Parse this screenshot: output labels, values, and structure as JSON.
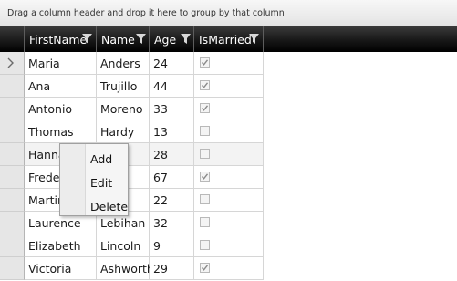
{
  "group_panel": {
    "hint": "Drag a column header and drop it here to group by that column"
  },
  "columns": [
    {
      "key": "first",
      "label": "FirstName"
    },
    {
      "key": "last",
      "label": "Name"
    },
    {
      "key": "age",
      "label": "Age"
    },
    {
      "key": "married",
      "label": "IsMarried"
    }
  ],
  "rows": [
    {
      "first": "Maria",
      "last": "Anders",
      "age": "24",
      "married": true,
      "current": true
    },
    {
      "first": "Ana",
      "last": "Trujillo",
      "age": "44",
      "married": true
    },
    {
      "first": "Antonio",
      "last": "Moreno",
      "age": "33",
      "married": true
    },
    {
      "first": "Thomas",
      "last": "Hardy",
      "age": "13",
      "married": false
    },
    {
      "first": "Hanna",
      "last": "",
      "age": "28",
      "married": false,
      "hover": true
    },
    {
      "first": "Frederi",
      "last": "ux",
      "age": "67",
      "married": true
    },
    {
      "first": "Martin",
      "last": "mer",
      "age": "22",
      "married": false
    },
    {
      "first": "Laurence",
      "last": "Lebihan",
      "age": "32",
      "married": false
    },
    {
      "first": "Elizabeth",
      "last": "Lincoln",
      "age": "9",
      "married": false
    },
    {
      "first": "Victoria",
      "last": "Ashworth",
      "age": "29",
      "married": true
    }
  ],
  "context_menu": {
    "items": [
      "Add",
      "Edit",
      "Delete"
    ]
  },
  "icons": {
    "filter": "funnel-filter-icon",
    "current_row": "current-row-arrow-icon"
  }
}
